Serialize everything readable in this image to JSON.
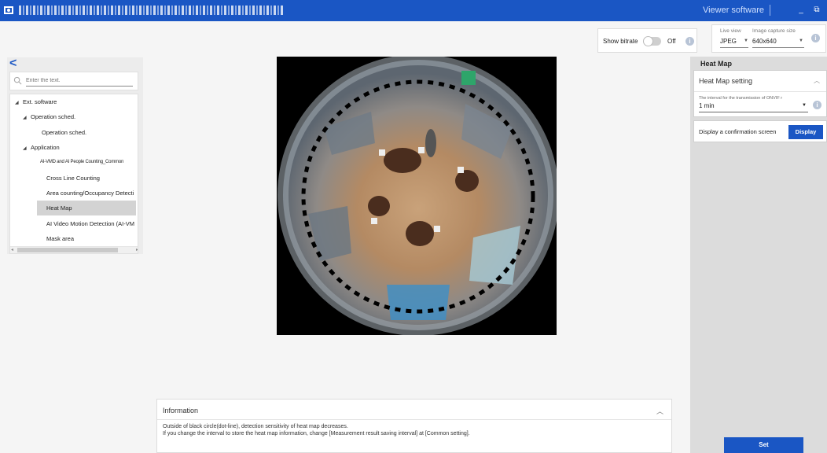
{
  "titlebar": {
    "window_title": "Viewer software",
    "minimize": "_",
    "restore": "⧉"
  },
  "toolbar": {
    "bitrate_label": "Show bitrate",
    "bitrate_state": "Off",
    "bitrate_on": false,
    "live_view_caption": "Live view",
    "live_view_value": "JPEG",
    "capture_size_caption": "Image capture size",
    "capture_size_value": "640x640"
  },
  "sidebar": {
    "search_placeholder": "Enter the text.",
    "items": [
      {
        "label": "Ext. software",
        "level": 0,
        "expander": "◢"
      },
      {
        "label": "Operation sched.",
        "level": 1,
        "expander": "◢"
      },
      {
        "label": "Operation sched.",
        "level": 2
      },
      {
        "label": "Application",
        "level": 1,
        "expander": "◢"
      },
      {
        "label": "AI-VMD and AI People Counting_Common",
        "level": 2
      },
      {
        "label": "Cross Line Counting",
        "level": 2
      },
      {
        "label": "Area counting/Occupancy Detecti",
        "level": 2
      },
      {
        "label": "Heat Map",
        "level": 2,
        "selected": true
      },
      {
        "label": "AI Video Motion Detection (AI-VM",
        "level": 2
      },
      {
        "label": "Mask area",
        "level": 2
      }
    ]
  },
  "information": {
    "title": "Information",
    "lines": [
      "Outside of black circle(dot-line), detection sensitivity of heat map decreases.",
      "If you change the interval to store the heat map information, change [Measurement result saving interval] at [Common setting]."
    ]
  },
  "right_panel": {
    "title": "Heat Map",
    "setting_title": "Heat Map setting",
    "interval_caption": "The interval for the transmission of ONVIF r",
    "interval_value": "1 min",
    "confirm_label": "Display a confirmation screen",
    "display_button": "Display",
    "set_button": "Set"
  },
  "colors": {
    "accent": "#1a56c4",
    "panel_gray": "#dcdcdc"
  }
}
